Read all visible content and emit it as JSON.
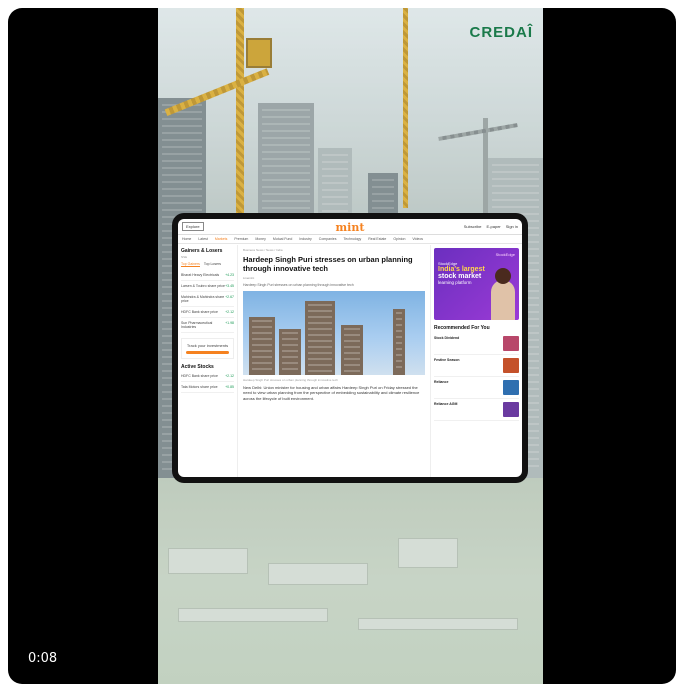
{
  "player": {
    "timestamp": "0:08"
  },
  "video": {
    "brand_logo": "CREDAÎ",
    "article_page": {
      "explore_label": "Explore",
      "site_logo": "mint",
      "top_links": [
        "Subscribe",
        "E-paper",
        "Sign in"
      ],
      "nav_items": [
        "Home",
        "Latest",
        "Markets",
        "Premium",
        "Money",
        "Mutual Fund",
        "Industry",
        "Companies",
        "Technology",
        "Real Estate",
        "Opinion",
        "Videos"
      ],
      "nav_active_index": 2,
      "gainers": {
        "title": "Gainers & Losers",
        "subtitle": "NSE",
        "tabs": [
          "Top Gainers",
          "Top Losers"
        ],
        "rows": [
          {
            "name": "Bharat Heavy Electricals",
            "value": "+4.23"
          },
          {
            "name": "Larsen & Toubro share price",
            "value": "+3.45"
          },
          {
            "name": "Mahindra & Mahindra share price",
            "value": "+2.67"
          },
          {
            "name": "HDFC Bank share price",
            "value": "+2.12"
          },
          {
            "name": "Sun Pharmaceutical Industries",
            "value": "+1.98"
          }
        ],
        "track_label": "Track your investments",
        "active_title": "Active Stocks",
        "active_rows": [
          {
            "name": "HDFC Bank share price",
            "value": "+2.12"
          },
          {
            "name": "Tata Motors share price",
            "value": "+0.85"
          }
        ]
      },
      "breadcrumb": "Business News / News / India",
      "headline": "Hardeep Singh Puri stresses on urban planning through innovative tech",
      "meta": "Livemint",
      "summary": "Hardeep Singh Puri stresses on urban planning through innovative tech",
      "photo_caption": "Hardeep Singh Puri stresses on urban planning through innovative tech",
      "body": "New Delhi: Union minister for housing and urban affairs Hardeep Singh Puri on Friday stressed the need to view urban planning from the perspective of embedding sustainability and climate resilience across the lifecycle of built environment.",
      "ad": {
        "brand": "StockEdge",
        "line1": "StockEdge",
        "line2": "India's largest",
        "line3": "stock market",
        "line4": "learning platform"
      },
      "recommended_title": "Recommended For You",
      "recommended": [
        {
          "title": "Stock Dividend",
          "thumb_color": "#b8476a"
        },
        {
          "title": "Festive Season",
          "thumb_color": "#c4512a"
        },
        {
          "title": "Reliance",
          "thumb_color": "#2f6fb0"
        },
        {
          "title": "Reliance AGM",
          "thumb_color": "#6a3aa0"
        }
      ]
    }
  }
}
